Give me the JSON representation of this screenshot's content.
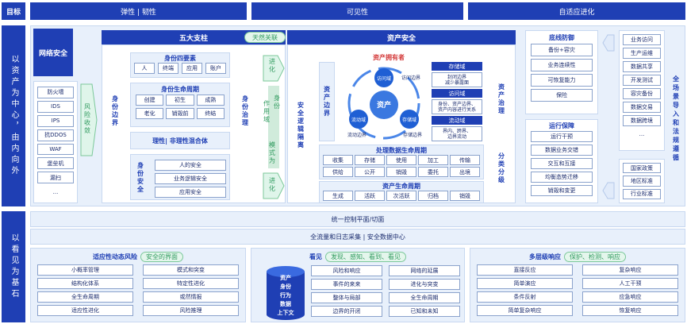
{
  "top": {
    "target": "目标",
    "cols": [
      "弹性 | 韧性",
      "可见性",
      "自适应进化"
    ]
  },
  "left_side": {
    "a": "以资产为中心，由内向外",
    "b": "以看见为基石"
  },
  "network": {
    "title": "网络安全",
    "items": [
      "防火墙",
      "IDS",
      "IPS",
      "抗DDOS",
      "WAF",
      "堡垒机",
      "漏扫",
      "..."
    ],
    "arrow": "风险收敛"
  },
  "pillars": {
    "header": "五大支柱",
    "natural": "天然关联",
    "identity_edge": "身份边界",
    "identity_gov": "身份治理",
    "four_elements": {
      "title": "身份四要素",
      "items": [
        "人",
        "终端",
        "应用",
        "账户"
      ]
    },
    "lifecycle": {
      "title": "身份生命周期",
      "items": [
        "创建",
        "初生",
        "成熟",
        "老化",
        "销毁前",
        "终结"
      ]
    },
    "mixed": "理性| 非理性混合体",
    "identity_sec": {
      "title": "身份安全",
      "items": [
        "人的安全",
        "业务逻辑安全",
        "应用安全"
      ]
    },
    "arrows": [
      "进化",
      "作用域",
      "身份",
      "模式为",
      "进化"
    ]
  },
  "asset": {
    "header": "资产安全",
    "isolation": "安全逻辑隔离",
    "asset_edge": "资产边界",
    "owner": "资产拥有者",
    "core": "资产",
    "domains": [
      "访问域",
      "存储域",
      "流动域"
    ],
    "nodes": [
      "访问边界",
      "存储边界",
      "流动边界"
    ],
    "store": {
      "title": "存储域",
      "desc": "封闭边界\n减少暴露面"
    },
    "access": {
      "title": "访问域",
      "desc": "身份、资产边界、\n资产内容进行关系"
    },
    "flow": {
      "title": "流动域",
      "desc": "界内、跨界、\n边界流动"
    },
    "data_lifecycle": {
      "title": "处理数据生命周期",
      "items": [
        "收集",
        "存储",
        "使用",
        "加工",
        "传输",
        "供给",
        "公开",
        "销毁",
        "委托",
        "出境"
      ]
    },
    "asset_lifecycle": {
      "title": "资产生命周期",
      "items": [
        "生成",
        "活跃",
        "次活跃",
        "归档",
        "销毁"
      ]
    },
    "governance": "资产治理",
    "grading": "分类分级"
  },
  "ops": {
    "baseline": {
      "title": "底线防御",
      "items": [
        "备份+容灾",
        "业务连续性",
        "可恢复能力",
        "保险"
      ]
    },
    "guarantee": {
      "title": "运行保障",
      "items": [
        "运行干预",
        "数据业务交错",
        "交互和互接",
        "均衡态势迁移",
        "销毁和变更"
      ]
    }
  },
  "right": {
    "vtitle": "全场景导入和法规遵循",
    "items1": [
      "业务访问",
      "生产运维",
      "数据共享",
      "开发测试",
      "容灾备份",
      "数据交易",
      "数据跨境",
      "..."
    ],
    "items2": [
      "国家政策",
      "地区标准",
      "行业标准"
    ]
  },
  "bars": {
    "b1": "统一控制平面/切面",
    "b2": "全流量和日志采集 | 安全数据中心"
  },
  "bottom": {
    "risk": {
      "title": "适应性动态风险",
      "badge": "安全的界面",
      "items": [
        "小概率管理",
        "模式和突变",
        "结构化体系",
        "特定性进化",
        "全生命周期",
        "或然情报",
        "适应性进化",
        "风险推理"
      ]
    },
    "see": {
      "title": "看见",
      "badge": "发现、感知、看到、看见",
      "db": [
        "资产",
        "身份",
        "行为",
        "数据",
        "上下文"
      ],
      "items": [
        "风险和响应",
        "网络的延展",
        "事件的来来",
        "进化与突变",
        "整体与局部",
        "全生命周期",
        "边界的开闭",
        "已知和未知"
      ]
    },
    "response": {
      "title": "多层级响应",
      "badge": "保护、检测、响应",
      "items": [
        "直接反应",
        "复杂响应",
        "简单演应",
        "人工干预",
        "条件反射",
        "应急响应",
        "简单复杂响应",
        "恢复响应"
      ]
    }
  }
}
